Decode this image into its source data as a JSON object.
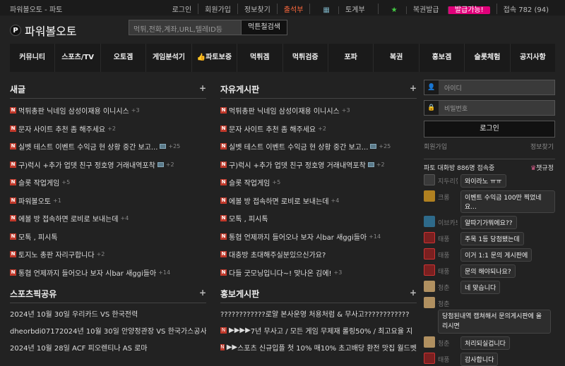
{
  "topbar": {
    "site_title": "파워볼오토 - 파토",
    "login": "로그인",
    "signup": "회원가입",
    "find": "정보찾기",
    "checkin": "출석부",
    "calendar": "토계부",
    "lotto": "복권발급",
    "lotto_badge": "발급가능!",
    "online": "접속 782 (94)"
  },
  "header": {
    "logo_letter": "P",
    "logo_text": "파워볼오토",
    "search_placeholder": "먹튀,전화,계좌,URL,텔레ID등",
    "search_button": "먹튼철검색"
  },
  "nav": [
    "커뮤니티",
    "스포츠/TV",
    "오토겜",
    "게임분석기",
    "파토보증",
    "먹튀겜",
    "먹튀검증",
    "포파",
    "복권",
    "홍보겜",
    "슬롯체험",
    "공지사항"
  ],
  "sections": {
    "new_title": "새글",
    "free_title": "자유게시판",
    "sports_title": "스포츠픽공유",
    "promo_title": "홍보게시판"
  },
  "new_posts": [
    {
      "t": "먹튀총판 닉네임 삼성이재용 이니시스",
      "c": "+3"
    },
    {
      "t": "문자 사이트 추천 좀 해주세요",
      "c": "+2"
    },
    {
      "t": "실벳 테스트 이벤트 수익금 현 상황 중간 보고...",
      "c": "+25"
    },
    {
      "t": "구)럭시 +추가 업뎃 친구 정호영 거래내역포착",
      "c": "+2"
    },
    {
      "t": "슬롯 작업게임",
      "c": "+5"
    },
    {
      "t": "파워볼오토",
      "c": "+1"
    },
    {
      "t": "에볼 방 접속하면 로비로 보내는데",
      "c": "+4"
    },
    {
      "t": "모톡 , 피시톡",
      "c": ""
    },
    {
      "t": "토지노 총판 자리구합니다",
      "c": "+2"
    },
    {
      "t": "통협 언제까지 들어오나 보자 시bar 새ggi들아",
      "c": "+14"
    }
  ],
  "free_posts": [
    {
      "t": "먹튀총판 닉네임 삼성이재용 이니시스",
      "c": "+3"
    },
    {
      "t": "문자 사이트 추천 좀 해주세요",
      "c": "+2"
    },
    {
      "t": "실벳 테스트 이벤트 수익금 현 상황 중간 보고...",
      "c": "+25"
    },
    {
      "t": "구)럭시 +추가 업뎃 친구 정호영 거래내역포착",
      "c": "+2"
    },
    {
      "t": "슬롯 작업게임",
      "c": "+5"
    },
    {
      "t": "에볼 방 접속하면 로비로 보내는데",
      "c": "+4"
    },
    {
      "t": "모톡 , 피시톡",
      "c": ""
    },
    {
      "t": "통협 언제까지 들어오나 보자 시bar 새ggi들아",
      "c": "+14"
    },
    {
      "t": "대충방 초대해주실분있으신가요?",
      "c": ""
    },
    {
      "t": "다들 굿모닝입니다~! 맞나온 김에!",
      "c": "+3"
    }
  ],
  "sports_posts": [
    "2024년 10월 30일 우리카드 VS 한국전력",
    "dheorbdi07172024년 10월 30일 안양정관장 VS 한국가스공사",
    "2024년 10월 28일 ACF 피오렌티나 AS 로마"
  ],
  "promo_posts": [
    "????????????로얄 본사운영 처용처럼 & 무사고????????????",
    "7년 무사고 / 모든 게임 무제재 롤링50% / 최고요율 지",
    "스포츠 신규입플 첫 10% 매10% 초고배당 환전 맛집 월드벳"
  ],
  "side": {
    "id_placeholder": "아이디",
    "pw_placeholder": "비밀번호",
    "login_button": "로그인",
    "signup": "회원가입",
    "find": "정보찾기",
    "chat_count_label": "파토 대화방 886명 접속중",
    "chat_rules": "챗규정"
  },
  "chat": [
    {
      "name": "지두리형님",
      "text": "와이라노 ㅠㅠ"
    },
    {
      "name": "크롱",
      "text": "이벤트 수익금 100만 찍었네요..."
    },
    {
      "name": "이브카보",
      "text": "알따기가뭐에요??"
    },
    {
      "name": "태풍",
      "text": "주목 1등 당첨됐는데"
    },
    {
      "name": "태풍",
      "text": "이거 1:1 문의 게시판에"
    },
    {
      "name": "태풍",
      "text": "문의 해야되나요?"
    },
    {
      "name": "청춘",
      "text": "네 맞습니다"
    },
    {
      "name": "청춘",
      "text": "당첨된내역 캡쳐해서 문의게시판에 올리시면"
    },
    {
      "name": "청춘",
      "text": "처리되실겁니다"
    },
    {
      "name": "태풍",
      "text": "감사합니다"
    }
  ]
}
